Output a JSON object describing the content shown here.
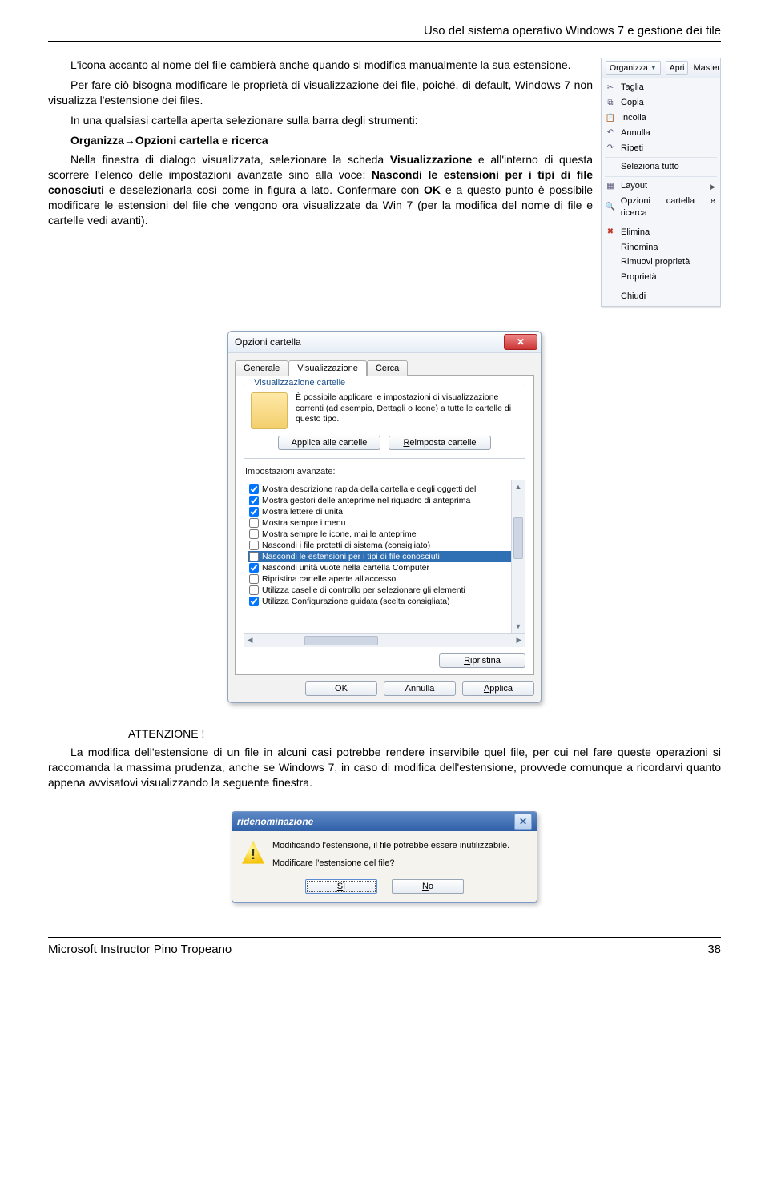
{
  "header": "Uso del sistema operativo Windows 7 e gestione dei file",
  "para1": "L'icona accanto al nome del file cambierà anche quando si modifica manualmente la sua estensione.",
  "para2": "Per fare ciò bisogna modificare le proprietà di visualizzazione dei file, poiché, di default, Windows 7 non visualizza l'estensione dei files.",
  "para3": "In una qualsiasi cartella aperta selezionare sulla barra degli strumenti:",
  "pathline_prefix": "Organizza",
  "pathline_suffix": "Opzioni cartella e ricerca",
  "para4a": "Nella finestra di dialogo visualizzata, selezionare la scheda ",
  "para4b": "Visualizzazione",
  "para4c": " e all'interno di questa scorrere l'elenco delle impostazioni avanzate sino alla voce: ",
  "para4d": "Nascondi le estensioni per i tipi di file conosciuti",
  "para4e": " e deselezionarla così come in figura a lato. Confermare con ",
  "para4f": "OK",
  "para4g": "  e a questo punto è possibile modificare le estensioni del file che vengono ora visualizzate da Win 7 (per la modifica del nome di file e cartelle vedi avanti).",
  "contextMenu": {
    "top": {
      "organizza": "Organizza",
      "apri": "Apri",
      "master": "Master"
    },
    "items": {
      "taglia": "Taglia",
      "copia": "Copia",
      "incolla": "Incolla",
      "annulla": "Annulla",
      "ripeti": "Ripeti",
      "seleziona": "Seleziona tutto",
      "layout": "Layout",
      "opzioni": "Opzioni cartella e ricerca",
      "elimina": "Elimina",
      "rinomina": "Rinomina",
      "rimuovi": "Rimuovi proprietà",
      "proprieta": "Proprietà",
      "chiudi": "Chiudi"
    }
  },
  "dialog": {
    "title": "Opzioni cartella",
    "tabs": {
      "generale": "Generale",
      "visual": "Visualizzazione",
      "cerca": "Cerca"
    },
    "group_title": "Visualizzazione cartelle",
    "group_desc": "È possibile applicare le impostazioni di visualizzazione correnti (ad esempio, Dettagli o Icone) a tutte le cartelle di questo tipo.",
    "btn_apply_all": "Applica alle cartelle",
    "btn_reset": "Reimposta cartelle",
    "adv_label": "Impostazioni avanzate:",
    "rows": [
      {
        "checked": true,
        "text": "Mostra descrizione rapida della cartella e degli oggetti del"
      },
      {
        "checked": true,
        "text": "Mostra gestori delle anteprime nel riquadro di anteprima"
      },
      {
        "checked": true,
        "text": "Mostra lettere di unità"
      },
      {
        "checked": false,
        "text": "Mostra sempre i menu"
      },
      {
        "checked": false,
        "text": "Mostra sempre le icone, mai le anteprime"
      },
      {
        "checked": false,
        "text": "Nascondi i file protetti di sistema (consigliato)"
      },
      {
        "checked": false,
        "text": "Nascondi le estensioni per i tipi di file conosciuti",
        "selected": true
      },
      {
        "checked": true,
        "text": "Nascondi unità vuote nella cartella Computer"
      },
      {
        "checked": false,
        "text": "Ripristina cartelle aperte all'accesso"
      },
      {
        "checked": false,
        "text": "Utilizza caselle di controllo per selezionare gli elementi"
      },
      {
        "checked": true,
        "text": "Utilizza Configurazione guidata (scelta consigliata)"
      }
    ],
    "btn_ripristina": "Ripristina",
    "btn_ok": "OK",
    "btn_annulla": "Annulla",
    "btn_applica": "Applica"
  },
  "attention_label": "ATTENZIONE !",
  "para5": "La modifica dell'estensione di un file in alcuni casi potrebbe rendere inservibile quel file, per cui nel fare queste operazioni si raccomanda la massima prudenza, anche se Windows 7, in caso di modifica dell'estensione, provvede comunque a ricordarvi quanto appena avvisatovi visualizzando la seguente finestra.",
  "rename": {
    "title": "ridenominazione",
    "line1": "Modificando l'estensione, il file potrebbe essere inutilizzabile.",
    "line2": "Modificare l'estensione del file?",
    "yes": "Sì",
    "no": "No"
  },
  "footer_left": "Microsoft Instructor Pino Tropeano",
  "footer_right": "38"
}
